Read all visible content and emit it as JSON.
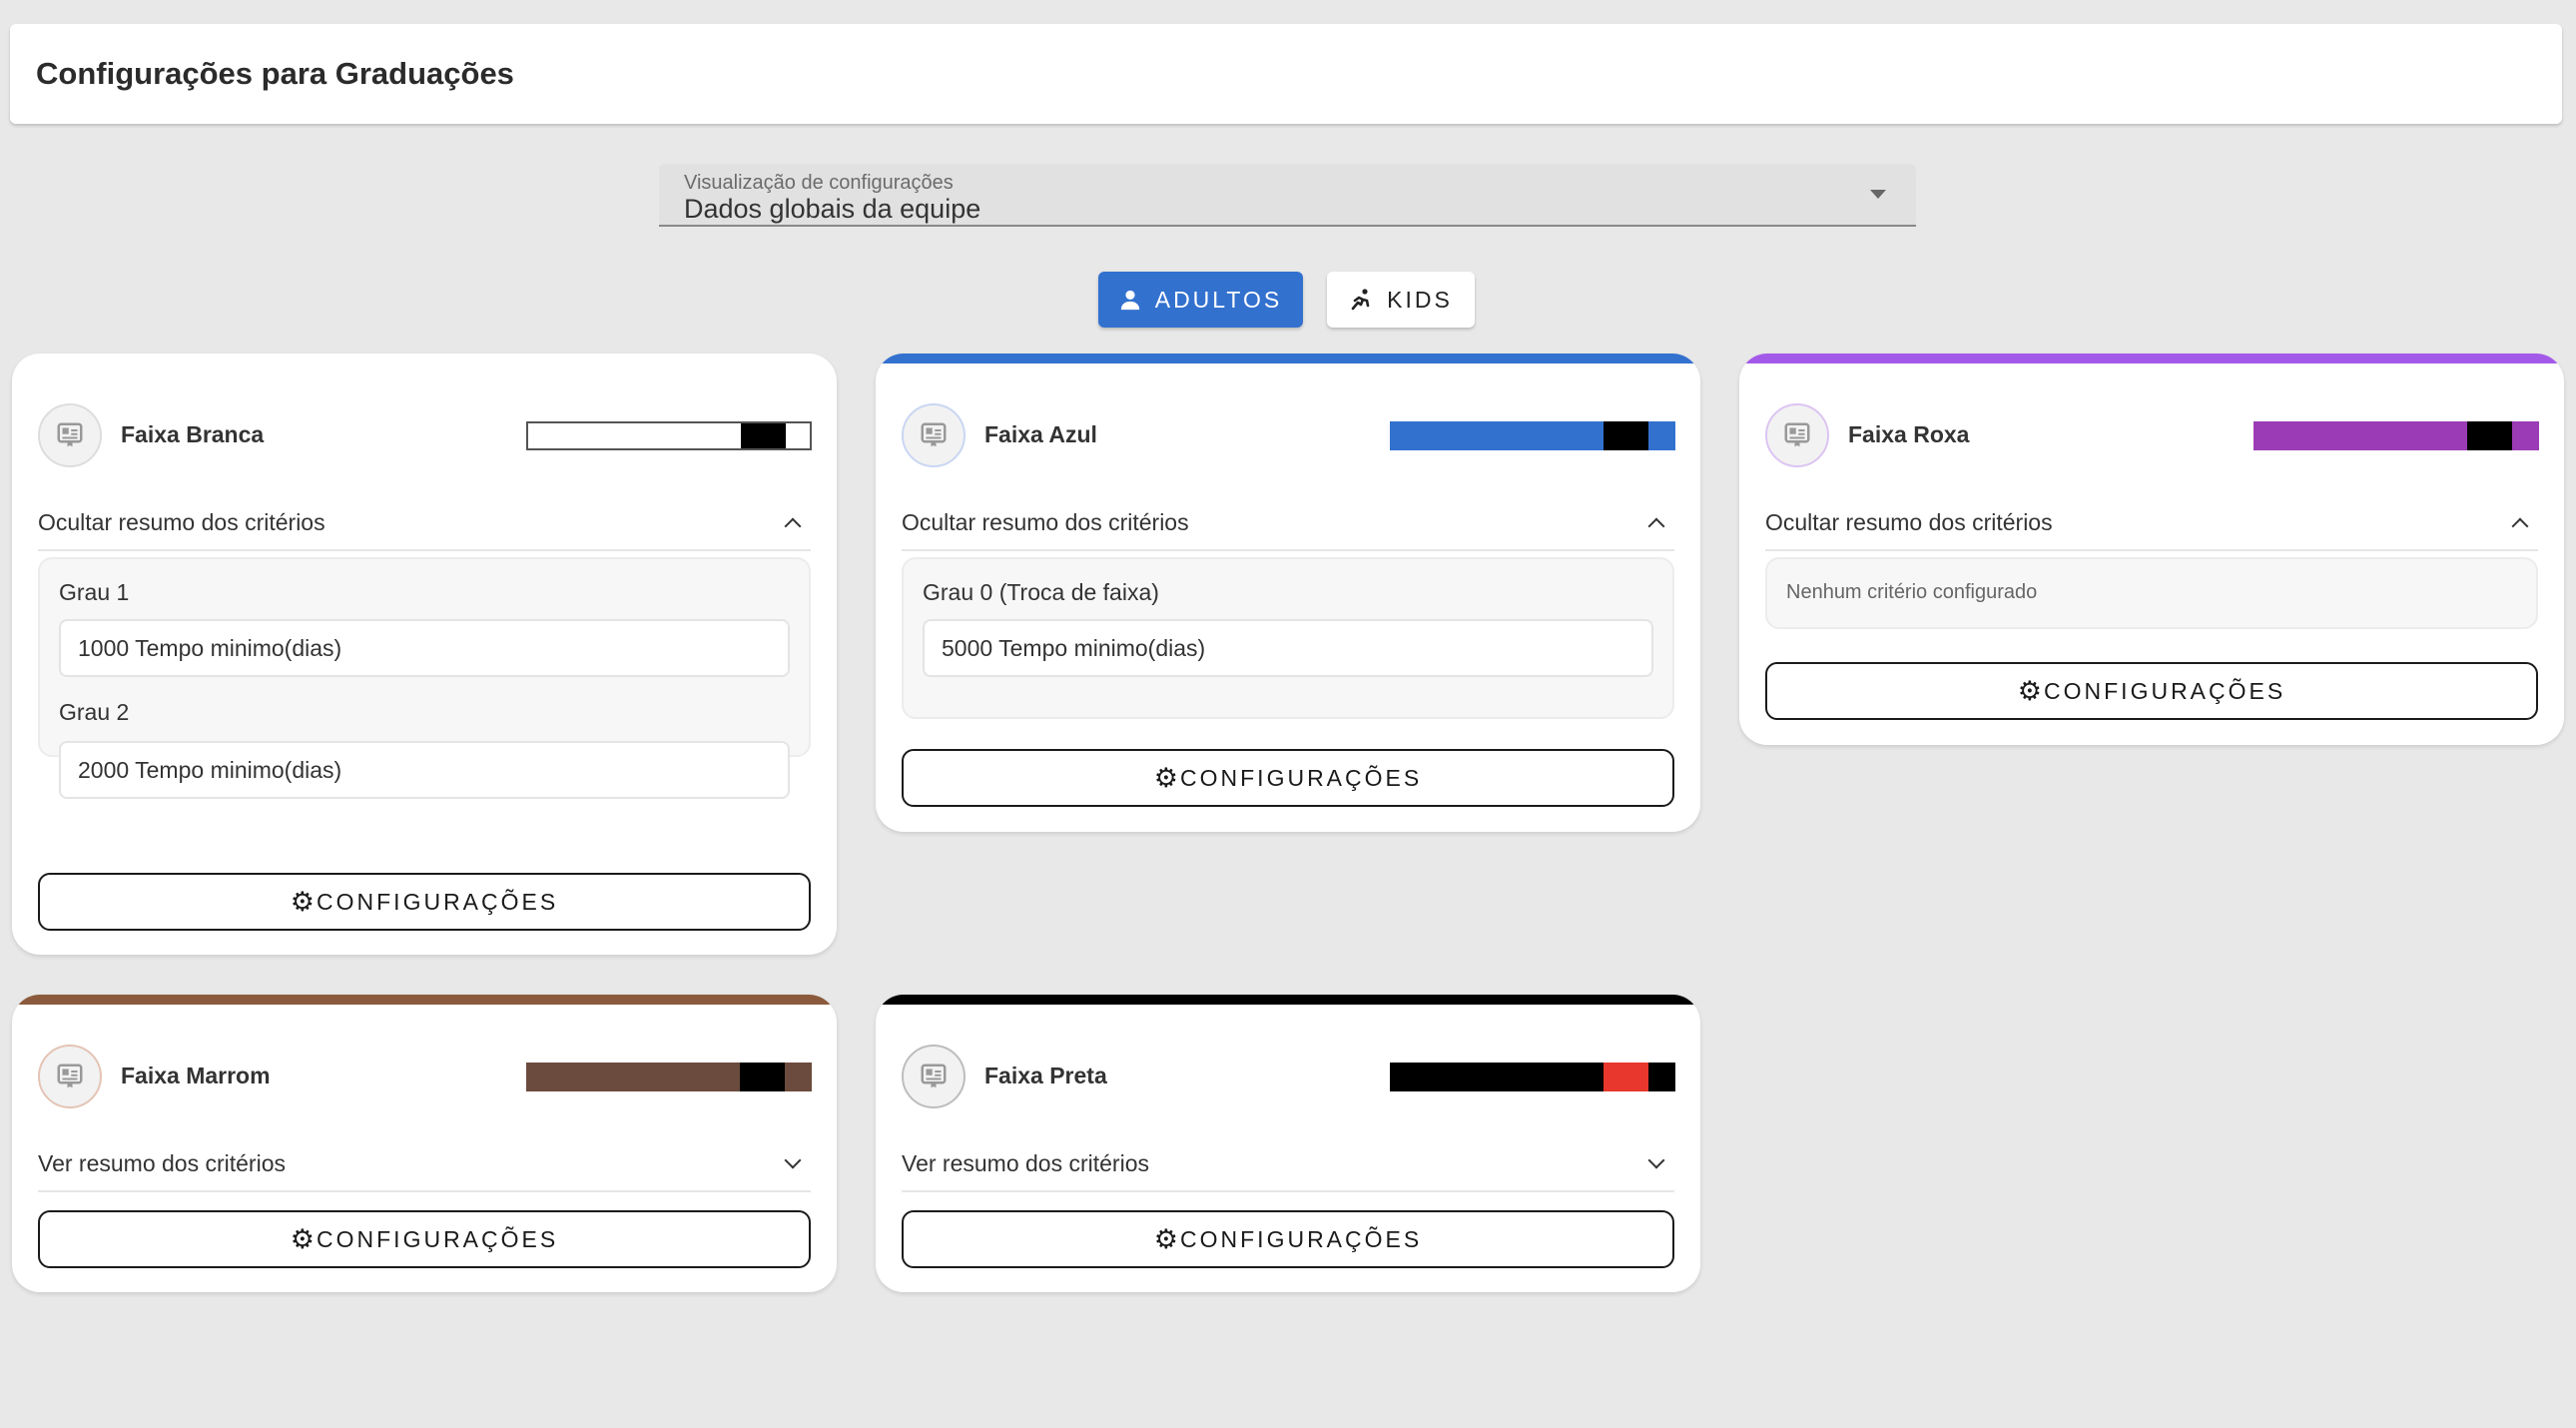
{
  "header": {
    "title": "Configurações para Graduações"
  },
  "view_select": {
    "label": "Visualização de configurações",
    "value": "Dados globais da equipe"
  },
  "toggles": {
    "adults": "ADULTOS",
    "kids": "KIDS"
  },
  "config_label": "CONFIGURAÇÕES",
  "cards": {
    "branca": {
      "name": "Faixa Branca",
      "criteria_toggle": "Ocultar resumo dos critérios",
      "criteria": [
        {
          "label": "Grau 1",
          "value": "1000 Tempo minimo(dias)"
        },
        {
          "label": "Grau 2",
          "value": "2000 Tempo minimo(dias)"
        }
      ],
      "colors": {
        "main": "#ffffff",
        "tip": "#000000",
        "accent": "#ffffff"
      }
    },
    "azul": {
      "name": "Faixa Azul",
      "criteria_toggle": "Ocultar resumo dos critérios",
      "criteria": [
        {
          "label": "Grau 0 (Troca de faixa)",
          "value": "5000 Tempo minimo(dias)"
        }
      ],
      "colors": {
        "main": "#3371cf",
        "tip": "#000000",
        "accent": "#3371cf"
      }
    },
    "roxa": {
      "name": "Faixa Roxa",
      "criteria_toggle": "Ocultar resumo dos critérios",
      "empty_text": "Nenhum critério configurado",
      "colors": {
        "main": "#9b3bb5",
        "tip": "#000000",
        "accent": "#a45ae8"
      }
    },
    "marrom": {
      "name": "Faixa Marrom",
      "criteria_toggle": "Ver resumo dos critérios",
      "colors": {
        "main": "#6b4b3e",
        "tip": "#000000",
        "accent": "#8b5a3c"
      }
    },
    "preta": {
      "name": "Faixa Preta",
      "criteria_toggle": "Ver resumo dos critérios",
      "colors": {
        "main": "#000000",
        "tip": "#e8372c",
        "accent": "#000000"
      }
    }
  }
}
